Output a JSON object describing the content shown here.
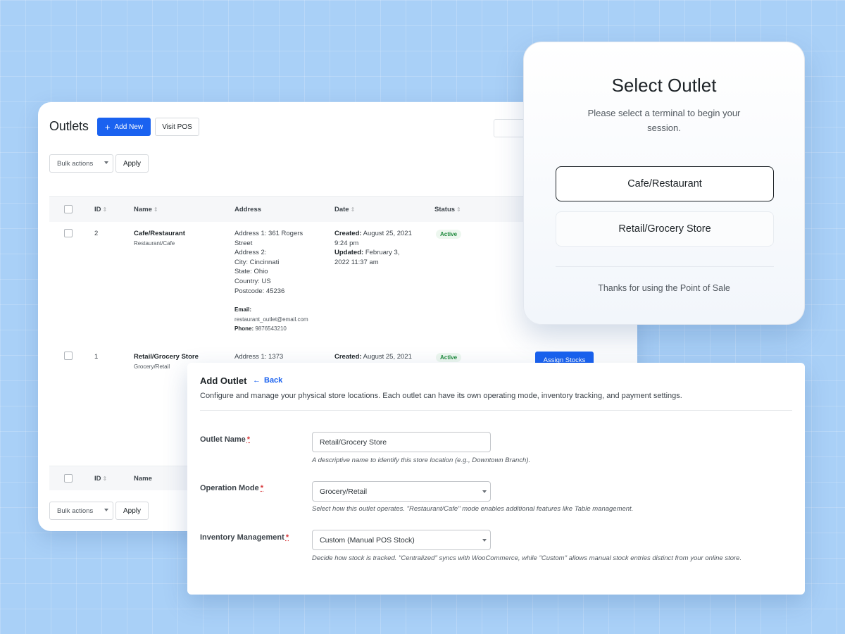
{
  "outlets_page": {
    "title": "Outlets",
    "add_new_label": "Add New",
    "visit_pos_label": "Visit POS",
    "bulk_actions_label": "Bulk actions",
    "apply_label": "Apply",
    "columns": {
      "id": "ID",
      "name": "Name",
      "address": "Address",
      "date": "Date",
      "status": "Status"
    },
    "rows": [
      {
        "id": "2",
        "name": "Cafe/Restaurant",
        "type": "Restaurant/Cafe",
        "address_lines": [
          "Address 1: 361 Rogers",
          "Street",
          "Address 2:",
          "City: Cincinnati",
          "State: Ohio",
          "Country: US",
          "Postcode: 45236"
        ],
        "email_label": "Email:",
        "email": "restaurant_outlet@email.com",
        "phone_label": "Phone:",
        "phone": "9876543210",
        "created_label": "Created:",
        "created_lines": [
          "August 25, 2021",
          "9:24 pm"
        ],
        "updated_label": "Updated:",
        "updated_lines": [
          "February 3,",
          "2022 11:37 am"
        ],
        "status": "Active"
      },
      {
        "id": "1",
        "name": "Retail/Grocery Store",
        "type": "Grocery/Retail",
        "address_lines": [
          "Address 1: 1373"
        ],
        "created_label": "Created:",
        "created_lines": [
          "August 25, 2021"
        ],
        "status": "Active",
        "assign_label": "Assign Stocks"
      }
    ]
  },
  "select_outlet": {
    "title": "Select Outlet",
    "subtitle": "Please select a terminal to begin your session.",
    "options": [
      "Cafe/Restaurant",
      "Retail/Grocery Store"
    ],
    "selected_option": "Cafe/Restaurant",
    "footer": "Thanks for using the Point of Sale"
  },
  "add_outlet": {
    "title": "Add Outlet",
    "back_label": "Back",
    "description": "Configure and manage your physical store locations. Each outlet can have its own operating mode, inventory tracking, and payment settings.",
    "required_mark": "*",
    "fields": {
      "outlet_name": {
        "label": "Outlet Name",
        "value": "Retail/Grocery Store",
        "help": "A descriptive name to identify this store location (e.g., Downtown Branch)."
      },
      "operation_mode": {
        "label": "Operation Mode",
        "value": "Grocery/Retail",
        "help": "Select how this outlet operates. \"Restaurant/Cafe\" mode enables additional features like Table management."
      },
      "inventory_management": {
        "label": "Inventory Management",
        "value": "Custom (Manual POS Stock)",
        "help": "Decide how stock is tracked. \"Centralized\" syncs with WooCommerce, while \"Custom\" allows manual stock entries distinct from your online store."
      }
    }
  },
  "colors": {
    "background": "#a9d0f7",
    "primary": "#1a62f0",
    "active_text": "#1e8a3c",
    "active_bg": "#edf7ef",
    "required": "#d63638"
  },
  "icons": {
    "add": "plus-icon",
    "back": "arrow-left-icon",
    "sort": "sort-icon",
    "dropdown": "chevron-down-icon"
  }
}
